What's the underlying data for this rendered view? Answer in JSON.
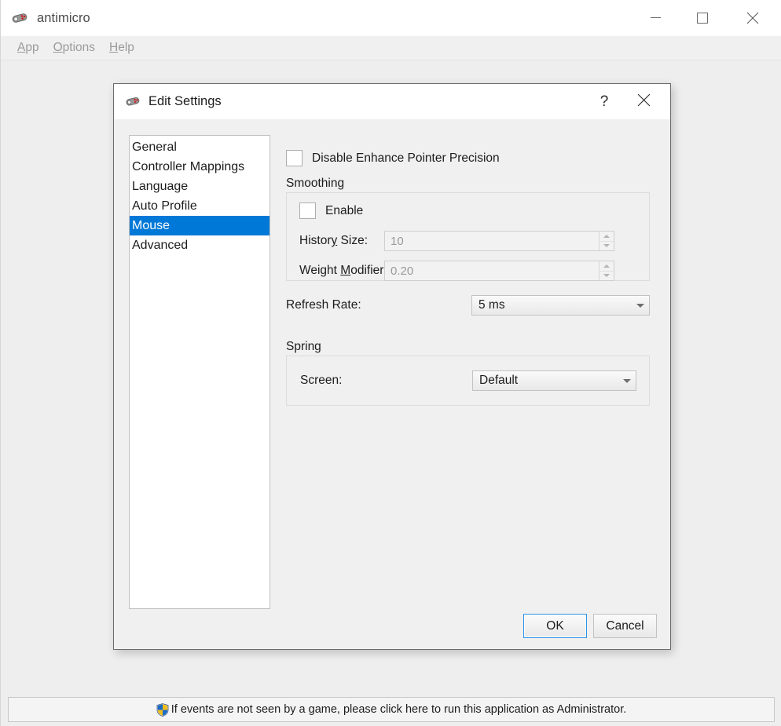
{
  "window": {
    "title": "antimicro",
    "icon": "gamepad-icon",
    "controls": {
      "minimize": "minimize-icon",
      "maximize": "maximize-icon",
      "close": "close-icon"
    }
  },
  "menubar": {
    "items": [
      {
        "label": "App",
        "mnemonic": "A",
        "rest": "pp"
      },
      {
        "label": "Options",
        "mnemonic": "O",
        "rest": "ptions"
      },
      {
        "label": "Help",
        "mnemonic": "H",
        "rest": "elp"
      }
    ]
  },
  "admin_bar": {
    "icon": "uac-shield-icon",
    "text": "If events are not seen by a game, please click here to run this application as Administrator."
  },
  "dialog": {
    "title": "Edit Settings",
    "icon": "gamepad-icon",
    "help_label": "?",
    "close_label": "close-icon",
    "settings_list": {
      "items": [
        {
          "label": "General",
          "selected": false
        },
        {
          "label": "Controller Mappings",
          "selected": false
        },
        {
          "label": "Language",
          "selected": false
        },
        {
          "label": "Auto Profile",
          "selected": false
        },
        {
          "label": "Mouse",
          "selected": true
        },
        {
          "label": "Advanced",
          "selected": false
        }
      ],
      "selected_value": "Mouse"
    },
    "mouse_page": {
      "disable_eph": {
        "label": "Disable Enhance Pointer Precision",
        "checked": false
      },
      "smoothing": {
        "group_label": "Smoothing",
        "enable": {
          "label": "Enable",
          "checked": false
        },
        "history_size": {
          "label_pre": "Histor",
          "label_mn": "y",
          "label_post": " Size:",
          "label": "History Size:",
          "value": "10",
          "enabled": false
        },
        "weight_modifier": {
          "label_pre": "Weight ",
          "label_mn": "M",
          "label_post": "odifier:",
          "label": "Weight Modifier:",
          "value": "0.20",
          "enabled": false
        }
      },
      "refresh_rate": {
        "label": "Refresh Rate:",
        "value": "5 ms"
      },
      "spring": {
        "group_label": "Spring",
        "screen": {
          "label": "Screen:",
          "value": "Default"
        }
      }
    },
    "buttons": {
      "ok": "OK",
      "cancel": "Cancel"
    }
  },
  "colors": {
    "accent": "#0078d7",
    "focus_border": "#2b93e8",
    "dialog_bg": "#f0f0f0",
    "window_bg": "#eeeeee",
    "disabled_text": "#9a9a9a"
  }
}
